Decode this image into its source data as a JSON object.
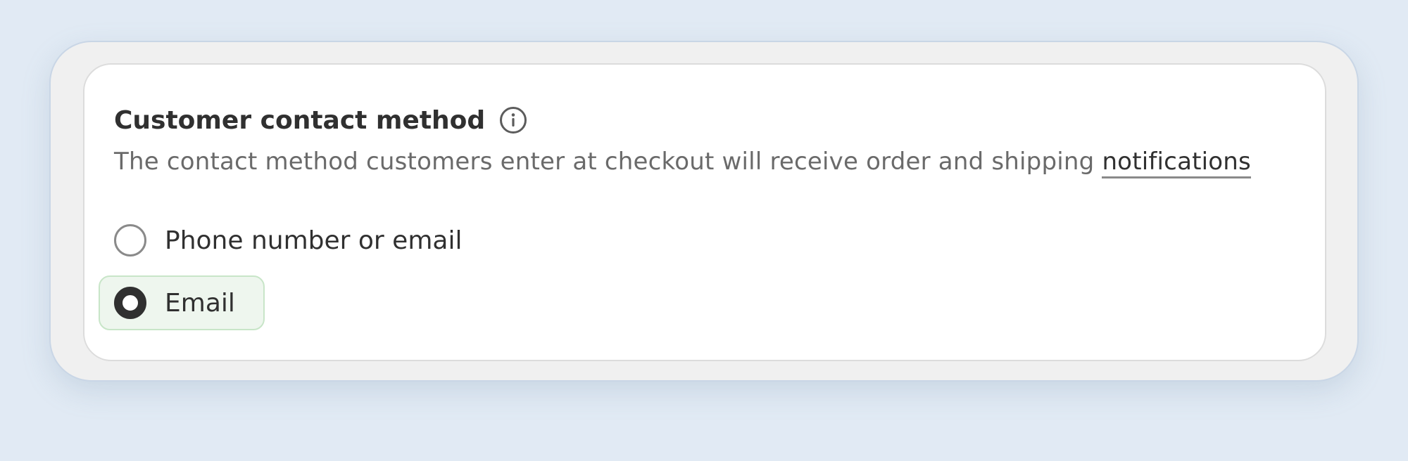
{
  "section": {
    "title": "Customer contact method",
    "info_icon": "info-circle-icon",
    "description_text": "The contact method customers enter at checkout will receive order and shipping ",
    "description_link": "notifications"
  },
  "options": [
    {
      "label": "Phone number or email",
      "selected": false
    },
    {
      "label": "Email",
      "selected": true
    }
  ],
  "colors": {
    "page_background": "#e1eaf4",
    "outer_card": "#f0f0f0",
    "inner_card": "#ffffff",
    "selected_option_background": "#eef6ee",
    "selected_option_border": "#c8e5c8",
    "text_primary": "#303030",
    "text_secondary": "#6a6a6a"
  }
}
